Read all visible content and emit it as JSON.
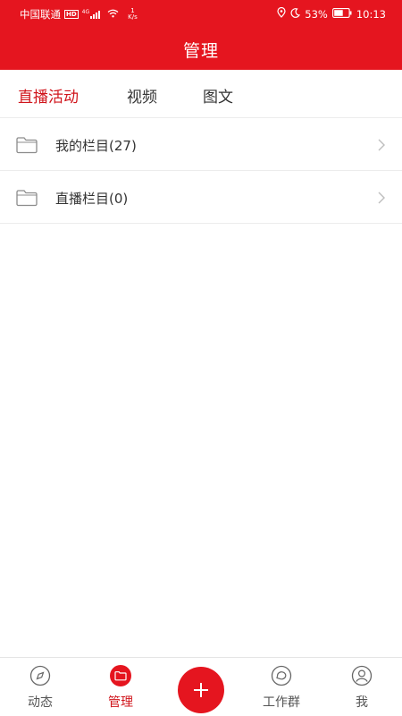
{
  "status_bar": {
    "carrier": "中国联通",
    "hd": "HD",
    "network": "4G",
    "speed_value": "1",
    "speed_unit": "K/s",
    "battery": "53%",
    "time": "10:13"
  },
  "header": {
    "title": "管理"
  },
  "tabs": [
    {
      "label": "直播活动",
      "active": true
    },
    {
      "label": "视频",
      "active": false
    },
    {
      "label": "图文",
      "active": false
    }
  ],
  "folders": [
    {
      "label": "我的栏目(27)"
    },
    {
      "label": "直播栏目(0)"
    }
  ],
  "bottom_nav": {
    "items": [
      {
        "label": "动态",
        "icon": "compass-icon",
        "active": false
      },
      {
        "label": "管理",
        "icon": "folder-icon",
        "active": true
      },
      {
        "label": "工作群",
        "icon": "chat-bubble-icon",
        "active": false
      },
      {
        "label": "我",
        "icon": "user-icon",
        "active": false
      }
    ],
    "fab_icon": "plus-icon"
  },
  "colors": {
    "accent": "#e5151f",
    "active_text": "#d0141b",
    "divider": "#ececec"
  }
}
